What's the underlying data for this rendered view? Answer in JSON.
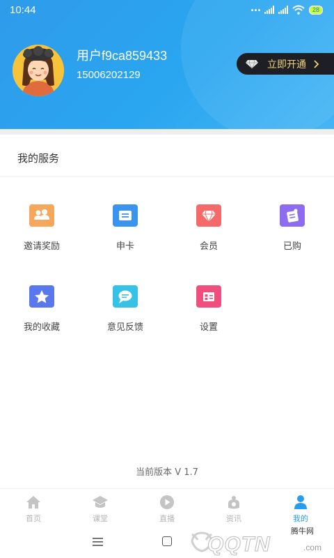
{
  "status_bar": {
    "time": "10:44",
    "battery": "28"
  },
  "user": {
    "name": "用户f9ca859433",
    "phone": "15006202129"
  },
  "vip": {
    "label": "立即开通"
  },
  "services": {
    "title": "我的服务",
    "items": [
      {
        "label": "邀请奖励",
        "icon": "people-icon",
        "color": "#f5a85b"
      },
      {
        "label": "申卡",
        "icon": "card-icon",
        "color": "#3a93ee"
      },
      {
        "label": "会员",
        "icon": "diamond-icon",
        "color": "#f46a6a"
      },
      {
        "label": "已购",
        "icon": "purchased-icon",
        "color": "#8d6cf0"
      },
      {
        "label": "我的收藏",
        "icon": "star-icon",
        "color": "#5a78ee"
      },
      {
        "label": "意见反馈",
        "icon": "chat-icon",
        "color": "#35c2e6"
      },
      {
        "label": "设置",
        "icon": "settings-icon",
        "color": "#f04f7e"
      }
    ]
  },
  "version": "当前版本 V 1.7",
  "tabs": [
    {
      "label": "首页",
      "icon": "home-icon"
    },
    {
      "label": "课堂",
      "icon": "graduation-cap-icon"
    },
    {
      "label": "直播",
      "icon": "play-icon"
    },
    {
      "label": "资讯",
      "icon": "news-icon"
    },
    {
      "label": "我的",
      "icon": "person-icon",
      "active": true
    }
  ],
  "watermark": {
    "top": "腾牛网",
    "main": "QQTN",
    "suffix": ".com"
  },
  "colors": {
    "accent": "#2a9cf0",
    "header": "#2f9bea",
    "vip_text": "#f3d17a"
  }
}
